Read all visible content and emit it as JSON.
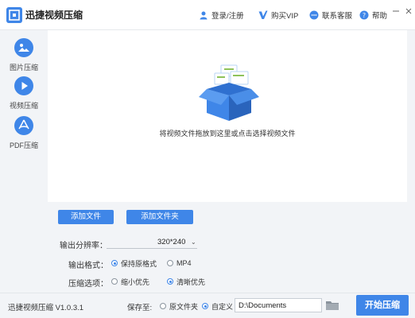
{
  "app": {
    "title": "迅捷视频压缩"
  },
  "header": {
    "login": "登录/注册",
    "vip": "购买VIP",
    "support": "联系客服",
    "help": "帮助"
  },
  "sidebar": {
    "items": [
      {
        "label": "图片压缩",
        "icon": "image-icon"
      },
      {
        "label": "视频压缩",
        "icon": "play-icon",
        "active": true
      },
      {
        "label": "PDF压缩",
        "icon": "pdf-icon"
      }
    ]
  },
  "drop_zone": {
    "hint": "将视频文件拖放到这里或点击选择视频文件"
  },
  "actions": {
    "add_file": "添加文件",
    "add_folder": "添加文件夹"
  },
  "options": {
    "resolution_label": "输出分辨率：",
    "resolution_value": "320*240",
    "format_label": "输出格式：",
    "format_options": [
      {
        "label": "保持原格式",
        "selected": true
      },
      {
        "label": "MP4",
        "selected": false
      }
    ],
    "compress_label": "压缩选项：",
    "compress_options": [
      {
        "label": "缩小优先",
        "selected": false
      },
      {
        "label": "清晰优先",
        "selected": true
      }
    ]
  },
  "footer": {
    "version": "迅捷视频压缩 V1.0.3.1",
    "save_label": "保存至:",
    "save_options": [
      {
        "label": "原文件夹",
        "selected": false
      },
      {
        "label": "自定义",
        "selected": true
      }
    ],
    "path_value": "D:\\Documents",
    "start": "开始压缩"
  },
  "colors": {
    "accent": "#3f86e8",
    "background": "#f2f4f7"
  }
}
